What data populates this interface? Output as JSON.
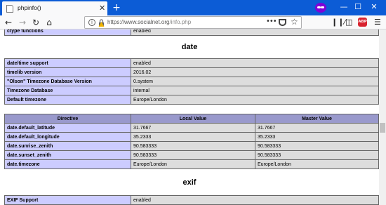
{
  "browser": {
    "tab_title": "phpinfo()",
    "url_host": "https://www.socialnet.org",
    "url_path": "/info.php",
    "new_tab_glyph": "+",
    "close_glyph": "✕"
  },
  "ctype": {
    "label": "ctype functions",
    "value": "enabled"
  },
  "date_section": {
    "heading": "date",
    "rows": [
      {
        "label": "date/time support",
        "value": "enabled"
      },
      {
        "label": "timelib version",
        "value": "2016.02"
      },
      {
        "label": "\"Olson\" Timezone Database Version",
        "value": "0.system"
      },
      {
        "label": "Timezone Database",
        "value": "internal"
      },
      {
        "label": "Default timezone",
        "value": "Europe/London"
      }
    ],
    "directive_headers": [
      "Directive",
      "Local Value",
      "Master Value"
    ],
    "directives": [
      {
        "name": "date.default_latitude",
        "local": "31.7667",
        "master": "31.7667"
      },
      {
        "name": "date.default_longitude",
        "local": "35.2333",
        "master": "35.2333"
      },
      {
        "name": "date.sunrise_zenith",
        "local": "90.583333",
        "master": "90.583333"
      },
      {
        "name": "date.sunset_zenith",
        "local": "90.583333",
        "master": "90.583333"
      },
      {
        "name": "date.timezone",
        "local": "Europe/London",
        "master": "Europe/London"
      }
    ]
  },
  "exif_section": {
    "heading": "exif",
    "rows": [
      {
        "label": "EXIF Support",
        "value": "enabled"
      }
    ]
  }
}
